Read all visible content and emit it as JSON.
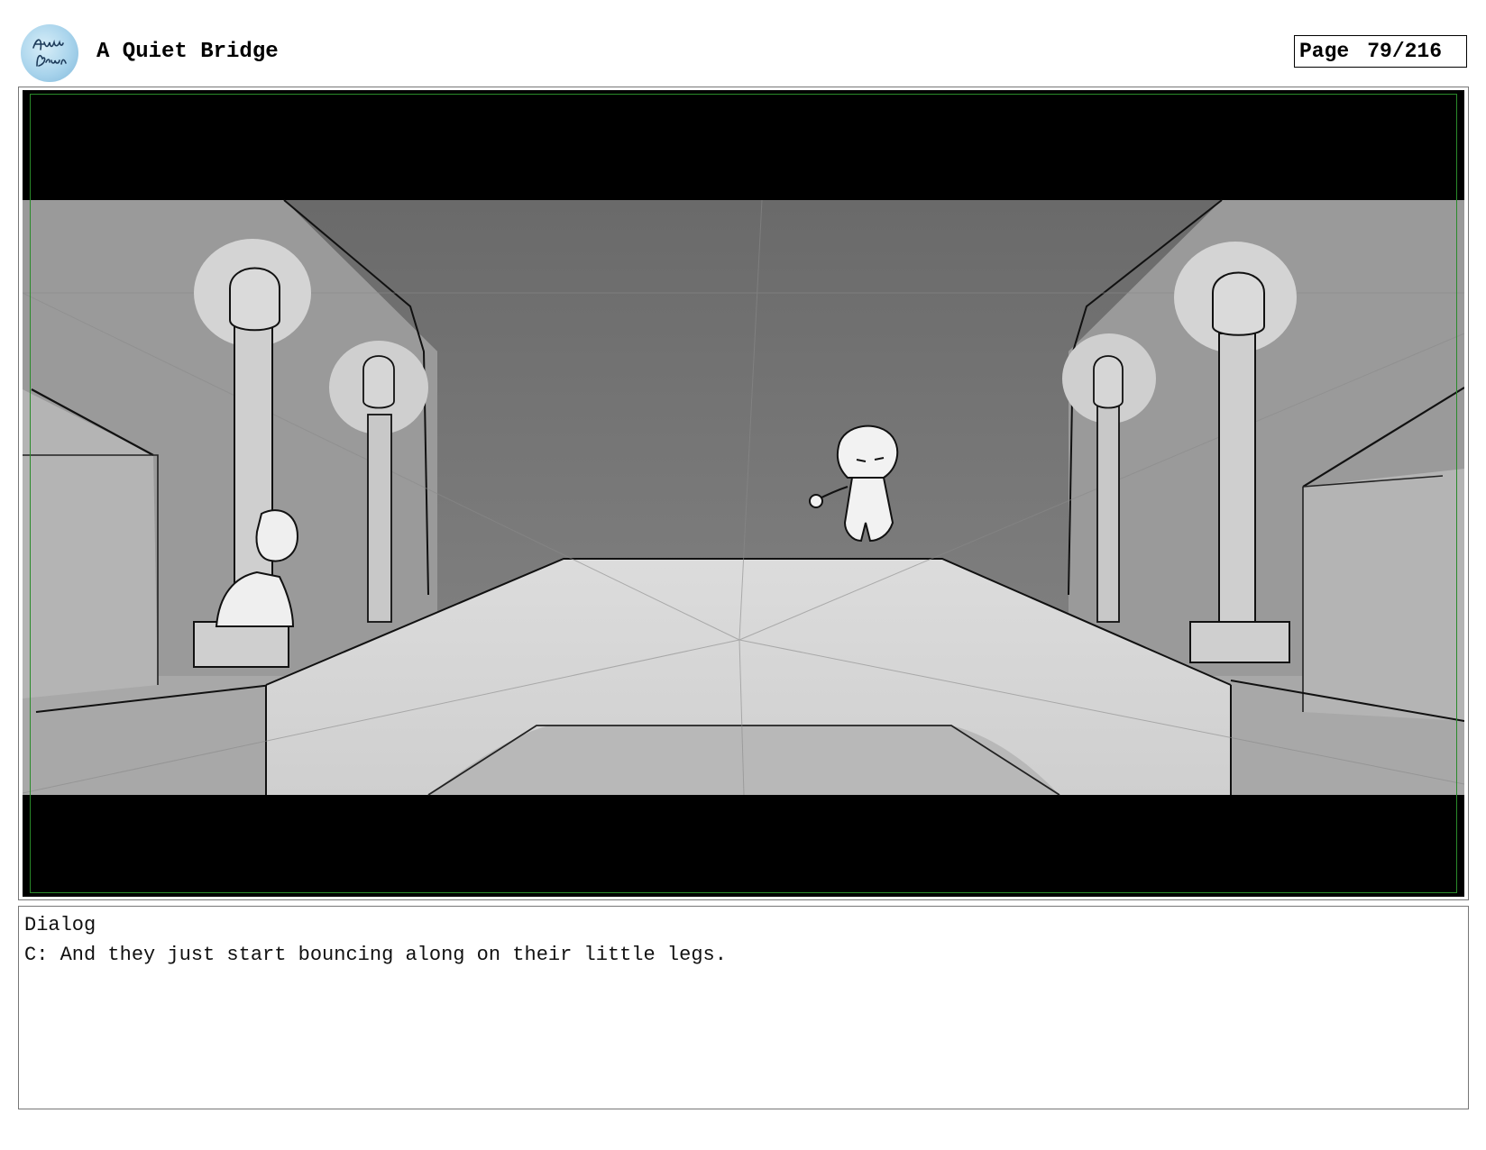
{
  "header": {
    "logo_icon": "artist-signature-logo-icon",
    "title": "A Quiet Bridge",
    "page_label": "Page",
    "page_number": "79/216"
  },
  "panel": {
    "image_icon": "storyboard-sketch-bridge-streetlamps",
    "safe_area_color": "#2a8a2a"
  },
  "dialog": {
    "label": "Dialog",
    "text": "C: And they just start bouncing along on their little legs."
  }
}
